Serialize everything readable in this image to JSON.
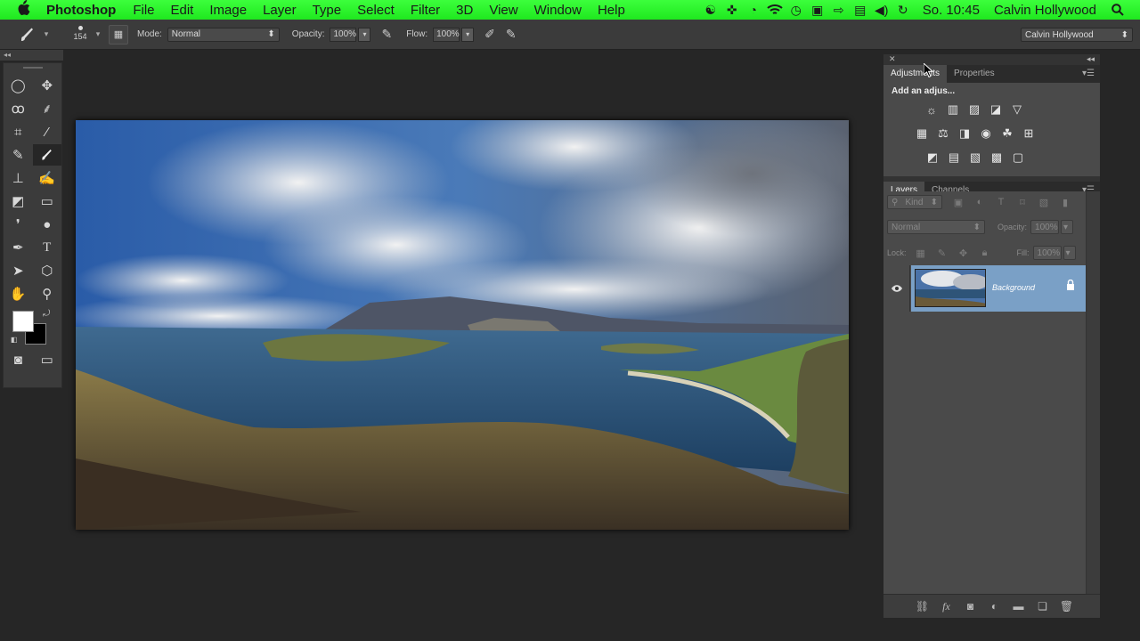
{
  "menubar": {
    "app": "Photoshop",
    "items": [
      "File",
      "Edit",
      "Image",
      "Layer",
      "Type",
      "Select",
      "Filter",
      "3D",
      "View",
      "Window",
      "Help"
    ],
    "clock": "So. 10:45",
    "user": "Calvin Hollywood",
    "status_icons": [
      "creative-cloud-icon",
      "gamepad-icon",
      "time-machine-icon",
      "wifi-icon",
      "clock-icon",
      "display-icon",
      "arrow-icon",
      "screen-icon",
      "volume-icon",
      "sync-icon"
    ]
  },
  "options": {
    "brush_size": "154",
    "mode_label": "Mode:",
    "mode_value": "Normal",
    "opacity_label": "Opacity:",
    "opacity_value": "100%",
    "flow_label": "Flow:",
    "flow_value": "100%",
    "workspace": "Calvin Hollywood"
  },
  "panels": {
    "adjustments_tab": "Adjustments",
    "properties_tab": "Properties",
    "adjustments_title": "Add an adjus...",
    "layers_tab": "Layers",
    "channels_tab": "Channels",
    "kind_label": "Kind",
    "blend_value": "Normal",
    "opacity_label": "Opacity:",
    "opacity_value": "100%",
    "lock_label": "Lock:",
    "fill_label": "Fill:",
    "fill_value": "100%",
    "layer_name": "Background"
  },
  "colors": {
    "menubar": "#2ef52e",
    "ui_dark": "#3b3b3b",
    "layer_selected": "#7aa0c6"
  }
}
